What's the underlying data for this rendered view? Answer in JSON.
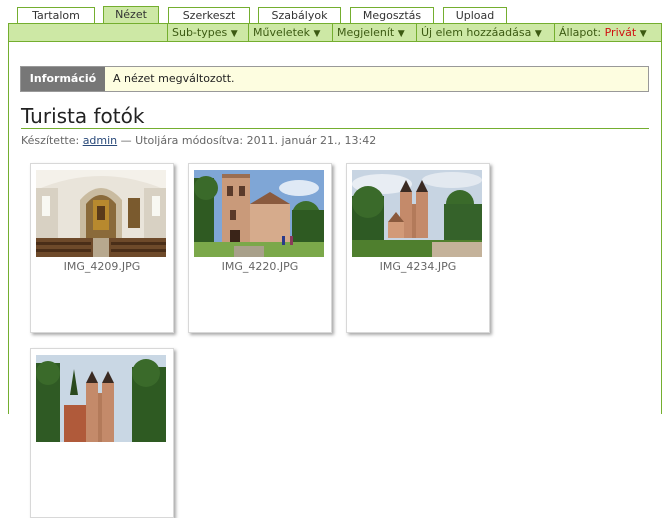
{
  "tabs": [
    {
      "label": "Tartalom",
      "active": false
    },
    {
      "label": "Nézet",
      "active": true
    },
    {
      "label": "Szerkeszt",
      "active": false
    },
    {
      "label": "Szabályok",
      "active": false
    },
    {
      "label": "Megosztás",
      "active": false
    },
    {
      "label": "Upload",
      "active": false
    }
  ],
  "actions": {
    "subtypes": "Sub-types",
    "muveletek": "Műveletek",
    "megjelenit": "Megjelenít",
    "uj_elem": "Új elem hozzáadása",
    "allapot_label": "Állapot:",
    "allapot_value": "Privát",
    "dropdown_arrow": "▼"
  },
  "info": {
    "label": "Információ",
    "message": "A nézet megváltozott."
  },
  "page": {
    "title": "Turista fotók",
    "byline_prefix": "Készítette:",
    "author": "admin",
    "byline_suffix": "— Utoljára módosítva: 2011. január 21., 13:42"
  },
  "images": [
    {
      "caption": "IMG_4209.JPG",
      "subject": "church-interior"
    },
    {
      "caption": "IMG_4220.JPG",
      "subject": "church-tower-blue-sky"
    },
    {
      "caption": "IMG_4234.JPG",
      "subject": "church-twin-towers"
    },
    {
      "caption": "",
      "subject": "church-towers-trees"
    }
  ],
  "colors": {
    "accent_green": "#74ae2f",
    "bar_green": "#cde8a5",
    "private_red": "#d01010",
    "info_label_bg": "#777777",
    "info_bg": "#fdfde0"
  }
}
